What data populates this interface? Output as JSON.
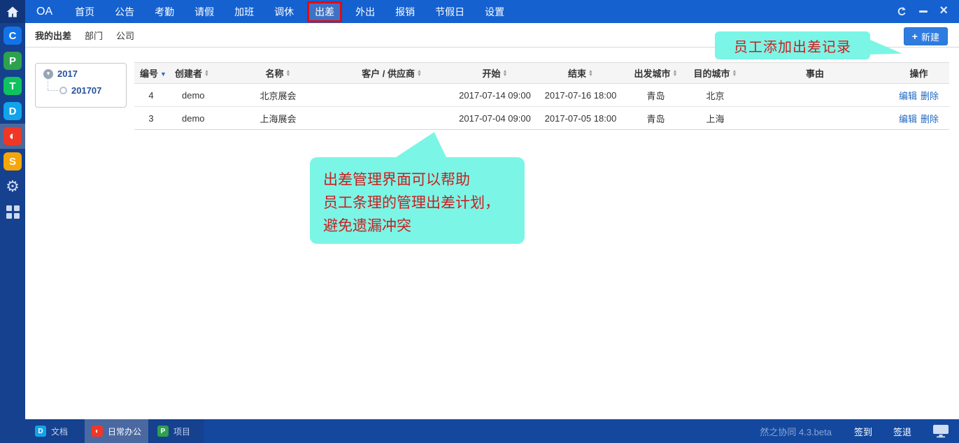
{
  "colors": {
    "topbar": "#1561d0",
    "sidebar": "#15418f",
    "bottombar": "#14489e",
    "active_tab_bg": "#3e72c7",
    "annotation_border": "#e30b0b",
    "callout_bg": "#7bf5e6",
    "callout_text": "#c91f1f",
    "primary_button": "#2e7ce0",
    "link": "#2269c3",
    "tree_text": "#25519b"
  },
  "topbar": {
    "brand": "OA",
    "menu": [
      "首页",
      "公告",
      "考勤",
      "请假",
      "加班",
      "调休",
      "出差",
      "外出",
      "报销",
      "节假日",
      "设置"
    ],
    "active_item": "出差"
  },
  "subnav": {
    "tabs": [
      {
        "label": "我的出差",
        "active": true
      },
      {
        "label": "部门",
        "active": false
      },
      {
        "label": "公司",
        "active": false
      }
    ],
    "new_button": {
      "plus": "+",
      "label": "新建"
    }
  },
  "sidebar": {
    "apps": [
      {
        "name": "app-c",
        "glyph": "C",
        "color": "#1273e6"
      },
      {
        "name": "app-p",
        "glyph": "P",
        "color": "#2da14e"
      },
      {
        "name": "app-t",
        "glyph": "T",
        "color": "#0fc25f"
      },
      {
        "name": "app-d",
        "glyph": "D",
        "color": "#12a3ec"
      },
      {
        "name": "app-oa",
        "glyph": "◐",
        "color": "#f03726",
        "active": true
      },
      {
        "name": "app-s",
        "glyph": "S",
        "color": "#f6a609"
      }
    ]
  },
  "tree": {
    "root": "2017",
    "child": "201707"
  },
  "table": {
    "columns": [
      {
        "label": "编号",
        "sort": "desc"
      },
      {
        "label": "创建者",
        "sort": "both"
      },
      {
        "label": "名称",
        "sort": "both"
      },
      {
        "label": "客户 / 供应商",
        "sort": "both"
      },
      {
        "label": "开始",
        "sort": "both"
      },
      {
        "label": "结束",
        "sort": "both"
      },
      {
        "label": "出发城市",
        "sort": "both"
      },
      {
        "label": "目的城市",
        "sort": "both"
      },
      {
        "label": "事由",
        "sort": "none"
      },
      {
        "label": "操作",
        "sort": "none"
      }
    ],
    "rows": [
      [
        "4",
        "demo",
        "北京展会",
        "",
        "2017-07-14 09:00",
        "2017-07-16 18:00",
        "青岛",
        "北京",
        ""
      ],
      [
        "3",
        "demo",
        "上海展会",
        "",
        "2017-07-04 09:00",
        "2017-07-05 18:00",
        "青岛",
        "上海",
        ""
      ]
    ],
    "actions": {
      "edit": "编辑",
      "delete": "删除"
    }
  },
  "annotations": {
    "top": "员工添加出差记录",
    "main": [
      "出差管理界面可以帮助",
      "员工条理的管理出差计划，",
      "避免遗漏冲突"
    ]
  },
  "taskbar": {
    "items": [
      {
        "label": "文档",
        "glyph": "D",
        "active": false
      },
      {
        "label": "日常办公",
        "glyph": "◐",
        "active": true
      },
      {
        "label": "项目",
        "glyph": "P",
        "active": false
      }
    ],
    "version": "然之协同 4.3.beta",
    "sign_in": "签到",
    "sign_out": "签退"
  }
}
